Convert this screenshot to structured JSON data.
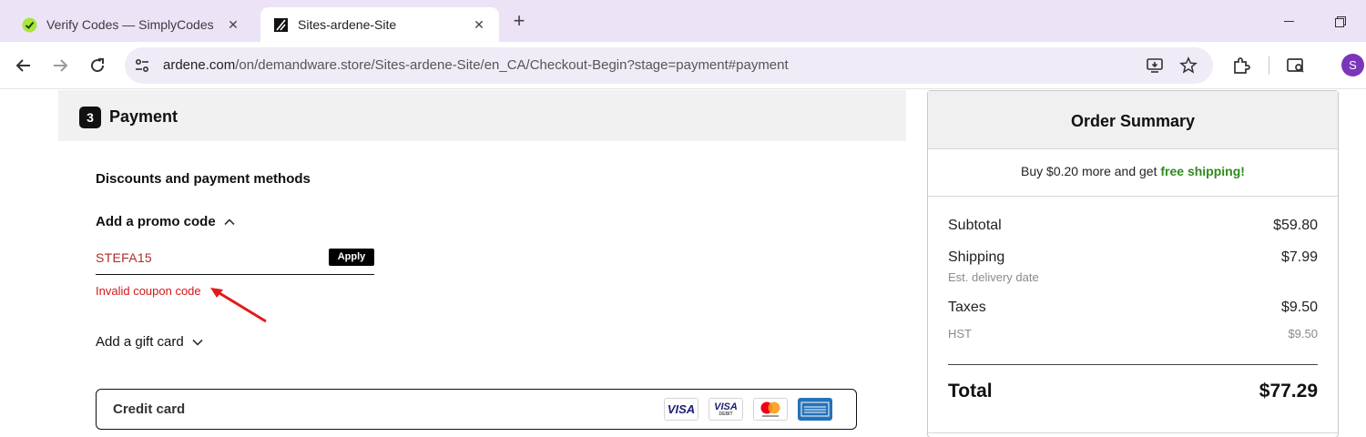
{
  "browser": {
    "tabs": [
      {
        "title": "Verify Codes — SimplyCodes",
        "icon": "simplycodes-icon",
        "active": false
      },
      {
        "title": "Sites-ardene-Site",
        "icon": "ardene-icon",
        "active": true
      }
    ],
    "url_domain": "ardene.com",
    "url_path": "/on/demandware.store/Sites-ardene-Site/en_CA/Checkout-Begin?stage=payment#payment",
    "profile_initial": "S",
    "colors": {
      "tabstrip": "#ece3f7",
      "omnibox": "#f1ebf7",
      "avatar": "#7a36b8"
    }
  },
  "checkout": {
    "step_number": "3",
    "step_title": "Payment",
    "discounts_heading": "Discounts and payment methods",
    "promo_label": "Add a promo code",
    "promo_value": "STEFA15",
    "apply_label": "Apply",
    "error_message": "Invalid coupon code",
    "gift_card_label": "Add a gift card",
    "payment_method_label": "Credit card",
    "card_logos": [
      "VISA",
      "VISA",
      "mastercard",
      "american-express"
    ],
    "card_visa_debit_sub": "DEBIT"
  },
  "summary": {
    "title": "Order Summary",
    "shipping_promo_prefix": "Buy $0.20 more and get ",
    "shipping_promo_highlight": "free shipping!",
    "subtotal_label": "Subtotal",
    "subtotal_value": "$59.80",
    "shipping_label": "Shipping",
    "shipping_value": "$7.99",
    "shipping_note": "Est. delivery date",
    "taxes_label": "Taxes",
    "taxes_value": "$9.50",
    "hst_label": "HST",
    "hst_value": "$9.50",
    "total_label": "Total",
    "total_value": "$77.29",
    "colors": {
      "free_shipping": "#2f8a1e",
      "error": "#d31818"
    }
  }
}
